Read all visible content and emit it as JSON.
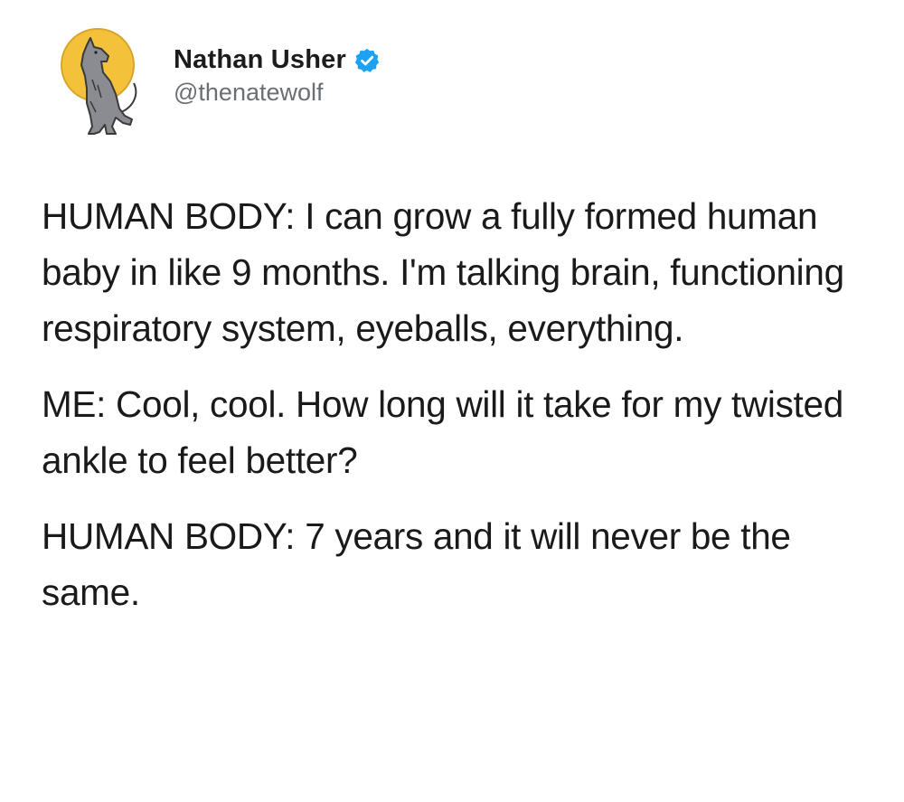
{
  "user": {
    "display_name": "Nathan Usher",
    "handle": "@thenatewolf",
    "avatar_icon": "howling-wolf-moon-avatar",
    "verified_icon": "verified-badge-icon",
    "verified_color": "#1da1f2"
  },
  "tweet": {
    "paragraphs": [
      "HUMAN BODY: I can grow a fully formed human baby in like 9 months. I'm talking brain, functioning respiratory system, eyeballs, everything.",
      "ME: Cool, cool. How long will it take for my twisted ankle to feel better?",
      "HUMAN BODY: 7 years and it will never be the same."
    ]
  },
  "colors": {
    "moon": "#f3c13a",
    "wolf": "#7d7f84",
    "text": "#1a1a1a",
    "handle": "#6b6f73"
  }
}
